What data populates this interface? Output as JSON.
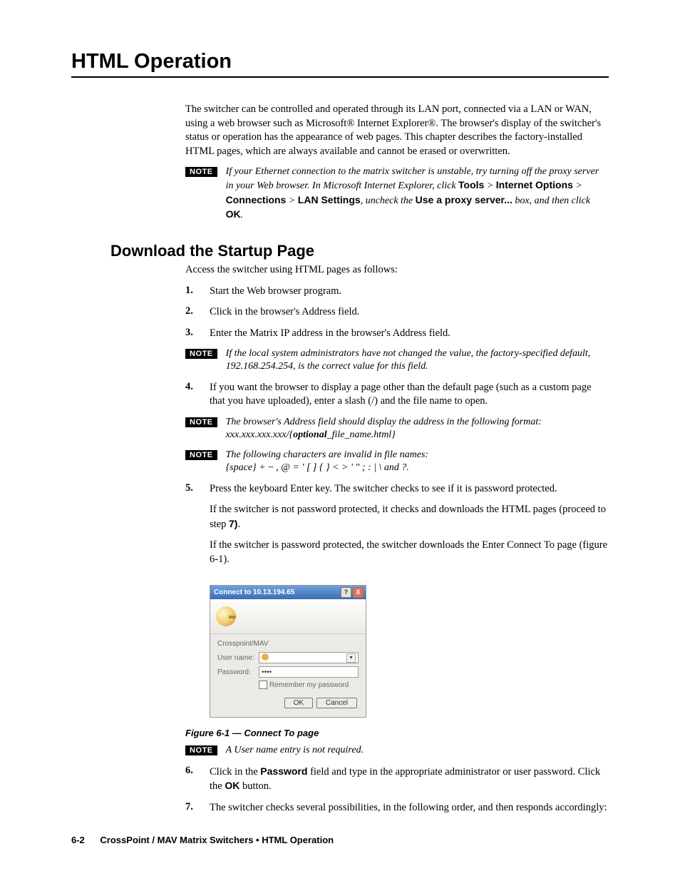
{
  "chapter_title": "HTML Operation",
  "intro": "The switcher can be controlled and operated through its LAN port, connected via a LAN or WAN, using a web browser such as Microsoft® Internet Explorer®. The browser's display of the switcher's status or operation has the appearance of web pages.  This chapter describes the factory-installed HTML pages, which are always available and cannot be erased or overwritten.",
  "note1_pre": "If your Ethernet connection to the matrix switcher is unstable, try turning off the proxy server in your Web browser.  In Microsoft Internet Explorer, click ",
  "note1_path": {
    "tools": "Tools",
    "io": "Internet Options",
    "conn": "Connections",
    "lan": "LAN Settings"
  },
  "note1_mid": ", uncheck the ",
  "note1_use": "Use a proxy server...",
  "note1_end": " box, and then click ",
  "note1_ok": "OK",
  "section_heading": "Download the Startup Page",
  "section_intro": "Access the switcher using HTML pages as follows:",
  "steps": {
    "s1": "Start the Web browser program.",
    "s2": "Click in the browser's Address field.",
    "s3": "Enter the Matrix IP address in the browser's Address field.",
    "note2": "If the local system administrators have not changed the value, the factory-specified default, 192.168.254.254, is the correct value for this field.",
    "s4": "If you want the browser to display a page other than the default page (such as a custom page that you have uploaded), enter a slash (/) and the file name to open.",
    "note3_pre": "The browser's Address field should display the address in the following format: xxx.xxx.xxx.xxx/{",
    "note3_opt": "optional",
    "note3_post": "_file_name.html}",
    "note4_l1": "The following characters are invalid in file names:",
    "note4_l2": "{space}  +  ~  ,  @  =  '  [  ]  {  }  <  >  '  \"  ;  :  |  \\  and ?.",
    "s5a": "Press the keyboard Enter key.  The switcher checks to see if it is password protected.",
    "s5b": "If the switcher is not password protected, it checks and downloads the HTML pages (proceed to step ",
    "s5b_bold": "7)",
    "s5b_end": ".",
    "s5c": "If the switcher is password protected, the switcher downloads the Enter Connect To page (figure 6-1).",
    "note5": "A User name entry is not required.",
    "s6_pre": "Click in the ",
    "s6_pw": "Password",
    "s6_mid": " field and type in the appropriate administrator or user password.  Click the ",
    "s6_ok": "OK",
    "s6_end": " button.",
    "s7": "The switcher checks several possibilities, in the following order, and then responds accordingly:"
  },
  "dialog": {
    "title": "Connect to 10.13.194.65",
    "help": "?",
    "close": "X",
    "group": "Crosspoint/MAV",
    "user_label": "User name:",
    "pass_label": "Password:",
    "pass_value": "••••",
    "remember": "Remember my password",
    "ok": "OK",
    "cancel": "Cancel"
  },
  "figure_caption": "Figure 6-1 — Connect To page",
  "footer": {
    "page": "6-2",
    "text": "CrossPoint / MAV Matrix Switchers • HTML Operation"
  },
  "note_label": "NOTE"
}
